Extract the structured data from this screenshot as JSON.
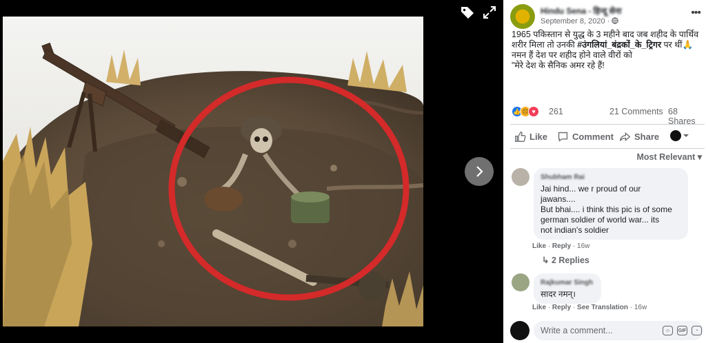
{
  "post": {
    "page_name": "Hindu Sena - हिन्दू सेना",
    "date": "September 8, 2020 · ",
    "text_line1": "1965 पकिस्तान से युद्ध के 3 महीने बाद जब शहीद के पार्थिव शरीर मिला तो उनकी ",
    "hashtag": "#उंगलियां_बंद्रकों_के_ट्रिगर",
    "text_line1_end": " पर थीं🙏",
    "text_line2": "नमन हैं देश पर शहीद होने वाले वीरों को",
    "text_line3": "\"मेरे देश के सैनिक अमर रहे हैं!",
    "more_label": "•••"
  },
  "stats": {
    "reaction_count": "261",
    "comments": "21 Comments",
    "shares": "68 Shares"
  },
  "actions": {
    "like": "Like",
    "comment": "Comment",
    "share": "Share"
  },
  "sort": {
    "label": "Most Relevant ▾"
  },
  "comments": [
    {
      "name": "Shubham Rai",
      "line1": "Jai hind... we r proud of our",
      "line2": "jawans....",
      "line3": "But bhai.... i think this pic is of some",
      "line4": "german soldier of world war... its",
      "line5": "not indian's soldier",
      "like": "Like",
      "reply": "Reply",
      "time": "16w",
      "replies": "2 Replies"
    },
    {
      "name": "Rajkumar Singh",
      "line1": "सादर नमन्।",
      "like": "Like",
      "reply": "Reply",
      "see_translation": "See Translation",
      "time": "16w"
    }
  ],
  "composer": {
    "placeholder": "Write a comment..."
  },
  "colors": {
    "viewer_bg": "#000000",
    "accent": "#1877f2",
    "circle_red": "#d42a2a"
  },
  "icons": [
    "tag-icon",
    "expand-icon",
    "next-arrow-icon",
    "globe-icon",
    "like-icon",
    "comment-icon",
    "share-icon",
    "emoji-icon",
    "gif-icon",
    "sticker-icon"
  ]
}
